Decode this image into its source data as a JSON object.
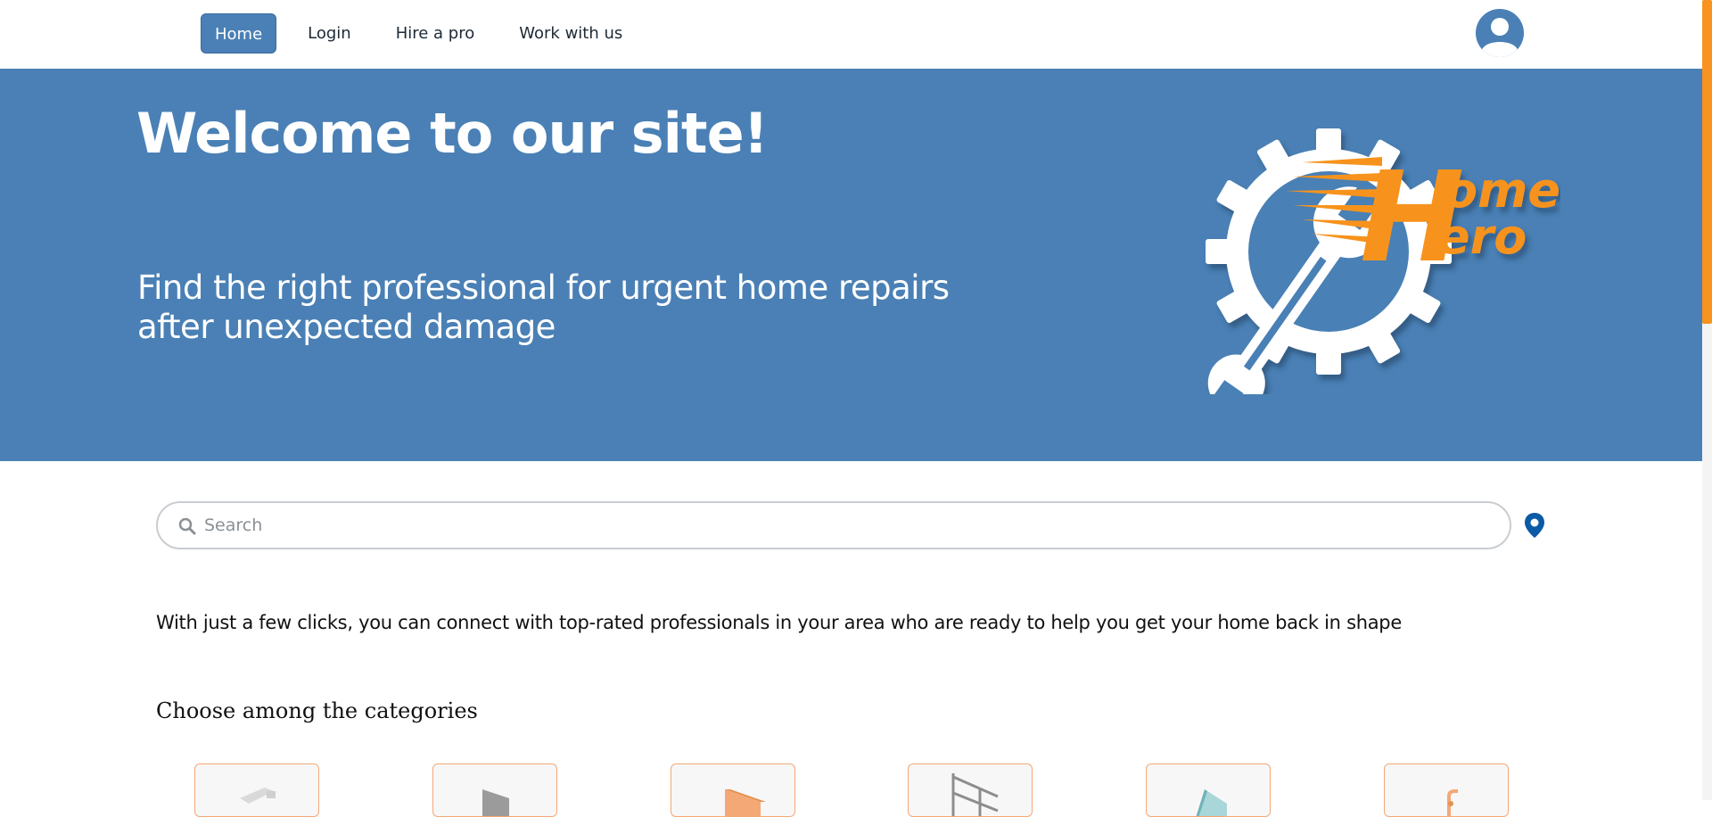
{
  "nav": {
    "items": [
      {
        "label": "Home",
        "active": true
      },
      {
        "label": "Login",
        "active": false
      },
      {
        "label": "Hire a pro",
        "active": false
      },
      {
        "label": "Work with us",
        "active": false
      }
    ],
    "avatar_icon": "user-avatar-icon"
  },
  "hero": {
    "title": "Welcome to our site!",
    "subtitle": "Find the right professional for urgent home repairs after unexpected damage",
    "logo_text": {
      "line1": "ome",
      "line2": "ero",
      "initial": "H"
    },
    "background_color": "#4a80b5",
    "accent_color": "#f7931e"
  },
  "search": {
    "placeholder": "Search",
    "value": "",
    "search_icon": "search-icon",
    "location_icon": "location-pin-icon"
  },
  "intro_text": "With just a few clicks, you can connect with top-rated professionals in your area who are ready to help you get your home back in shape",
  "categories": {
    "heading": "Choose among the categories",
    "items": [
      {
        "icon": "category-icon-1"
      },
      {
        "icon": "category-icon-2"
      },
      {
        "icon": "category-icon-3"
      },
      {
        "icon": "category-icon-4"
      },
      {
        "icon": "category-icon-5"
      },
      {
        "icon": "category-icon-6"
      }
    ]
  }
}
